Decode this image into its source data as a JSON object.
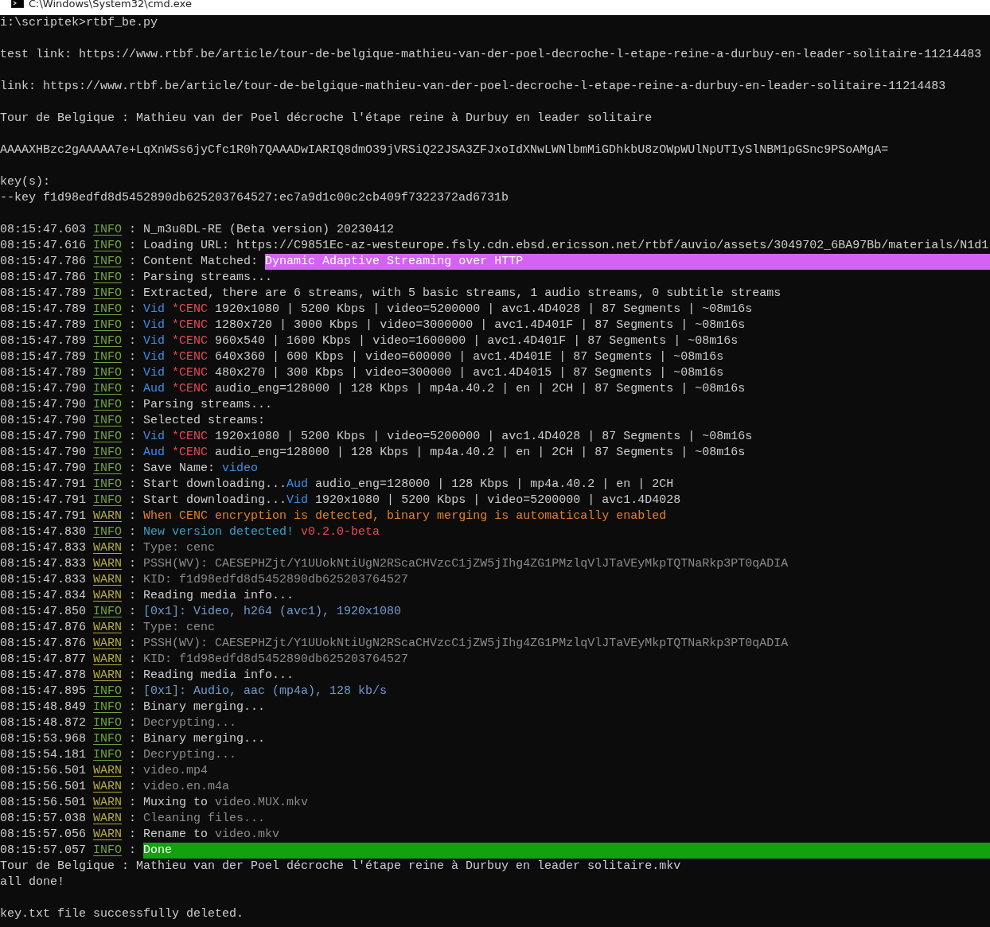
{
  "window": {
    "title": "C:\\Windows\\System32\\cmd.exe"
  },
  "lines": [
    {
      "kind": "plain",
      "text": "i:\\scriptek>rtbf_be.py"
    },
    {
      "kind": "blank"
    },
    {
      "kind": "plain",
      "text": "test link: https://www.rtbf.be/article/tour-de-belgique-mathieu-van-der-poel-decroche-l-etape-reine-a-durbuy-en-leader-solitaire-11214483"
    },
    {
      "kind": "blank"
    },
    {
      "kind": "plain",
      "text": "link: https://www.rtbf.be/article/tour-de-belgique-mathieu-van-der-poel-decroche-l-etape-reine-a-durbuy-en-leader-solitaire-11214483"
    },
    {
      "kind": "blank"
    },
    {
      "kind": "plain",
      "text": "Tour de Belgique : Mathieu van der Poel décroche l'étape reine à Durbuy en leader solitaire"
    },
    {
      "kind": "blank"
    },
    {
      "kind": "plain",
      "text": "AAAAXHBzc2gAAAAA7e+LqXnWSs6jyCfc1R0h7QAAADwIARIQ8dmO39jVRSiQ22JSA3ZFJxoIdXNwLWNlbmMiGDhkbU8zOWpWUlNpUTIySlNBM1pGSnc9PSoAMgA="
    },
    {
      "kind": "blank"
    },
    {
      "kind": "plain",
      "text": "key(s):"
    },
    {
      "kind": "plain",
      "text": "--key f1d98edfd8d5452890db625203764527:ec7a9d1c00c2cb409f7322372ad6731b"
    },
    {
      "kind": "blank"
    },
    {
      "kind": "log",
      "time": "08:15:47.603",
      "level": "INFO",
      "sep": ":",
      "parts": [
        {
          "text": "N_m3u8DL-RE (Beta version) 20230412",
          "kind": "normal"
        }
      ]
    },
    {
      "kind": "log",
      "time": "08:15:47.616",
      "level": "INFO",
      "sep": ":",
      "parts": [
        {
          "text": "Loading URL: https://C9851Ec-az-westeurope.fsly.cdn.ebsd.ericsson.net/rtbf/auvio/assets/3049702_6BA97Bb/materials/N1d1",
          "kind": "normal"
        }
      ]
    },
    {
      "kind": "log",
      "time": "08:15:47.786",
      "level": "INFO",
      "sep": ":",
      "parts": [
        {
          "text": "Content Matched:",
          "kind": "normal"
        },
        {
          "text": "Dynamic Adaptive Streaming over HTTP",
          "kind": "magenta-bar"
        }
      ]
    },
    {
      "kind": "log",
      "time": "08:15:47.786",
      "level": "INFO",
      "sep": ":",
      "parts": [
        {
          "text": "Parsing streams...",
          "kind": "normal"
        }
      ]
    },
    {
      "kind": "log",
      "time": "08:15:47.789",
      "level": "INFO",
      "sep": ":",
      "parts": [
        {
          "text": "Extracted, there are 6 streams, with 5 basic streams, 1 audio streams, 0 subtitle streams",
          "kind": "normal"
        }
      ]
    },
    {
      "kind": "log",
      "time": "08:15:47.789",
      "level": "INFO",
      "sep": ":",
      "parts": [
        {
          "text": "Vid",
          "kind": "blue"
        },
        {
          "text": "*CENC",
          "kind": "red"
        },
        {
          "text": "1920x1080 | 5200 Kbps | video=5200000 | avc1.4D4028 | 87 Segments | ~08m16s",
          "kind": "normal"
        }
      ]
    },
    {
      "kind": "log",
      "time": "08:15:47.789",
      "level": "INFO",
      "sep": ":",
      "parts": [
        {
          "text": "Vid",
          "kind": "blue"
        },
        {
          "text": "*CENC",
          "kind": "red"
        },
        {
          "text": "1280x720 | 3000 Kbps | video=3000000 | avc1.4D401F | 87 Segments | ~08m16s",
          "kind": "normal"
        }
      ]
    },
    {
      "kind": "log",
      "time": "08:15:47.789",
      "level": "INFO",
      "sep": ":",
      "parts": [
        {
          "text": "Vid",
          "kind": "blue"
        },
        {
          "text": "*CENC",
          "kind": "red"
        },
        {
          "text": "960x540 | 1600 Kbps | video=1600000 | avc1.4D401F | 87 Segments | ~08m16s",
          "kind": "normal"
        }
      ]
    },
    {
      "kind": "log",
      "time": "08:15:47.789",
      "level": "INFO",
      "sep": ":",
      "parts": [
        {
          "text": "Vid",
          "kind": "blue"
        },
        {
          "text": "*CENC",
          "kind": "red"
        },
        {
          "text": "640x360 | 600 Kbps | video=600000 | avc1.4D401E | 87 Segments | ~08m16s",
          "kind": "normal"
        }
      ]
    },
    {
      "kind": "log",
      "time": "08:15:47.789",
      "level": "INFO",
      "sep": ":",
      "parts": [
        {
          "text": "Vid",
          "kind": "blue"
        },
        {
          "text": "*CENC",
          "kind": "red"
        },
        {
          "text": "480x270 | 300 Kbps | video=300000 | avc1.4D4015 | 87 Segments | ~08m16s",
          "kind": "normal"
        }
      ]
    },
    {
      "kind": "log",
      "time": "08:15:47.790",
      "level": "INFO",
      "sep": ":",
      "parts": [
        {
          "text": "Aud",
          "kind": "blue"
        },
        {
          "text": "*CENC",
          "kind": "red"
        },
        {
          "text": "audio_eng=128000 | 128 Kbps | mp4a.40.2 | en | 2CH | 87 Segments | ~08m16s",
          "kind": "normal"
        }
      ]
    },
    {
      "kind": "log",
      "time": "08:15:47.790",
      "level": "INFO",
      "sep": ":",
      "parts": [
        {
          "text": "Parsing streams...",
          "kind": "normal"
        }
      ]
    },
    {
      "kind": "log",
      "time": "08:15:47.790",
      "level": "INFO",
      "sep": ":",
      "parts": [
        {
          "text": "Selected streams:",
          "kind": "normal"
        }
      ]
    },
    {
      "kind": "log",
      "time": "08:15:47.790",
      "level": "INFO",
      "sep": ":",
      "parts": [
        {
          "text": "Vid",
          "kind": "blue"
        },
        {
          "text": "*CENC",
          "kind": "red"
        },
        {
          "text": "1920x1080 | 5200 Kbps | video=5200000 | avc1.4D4028 | 87 Segments | ~08m16s",
          "kind": "normal"
        }
      ]
    },
    {
      "kind": "log",
      "time": "08:15:47.790",
      "level": "INFO",
      "sep": ":",
      "parts": [
        {
          "text": "Aud",
          "kind": "blue"
        },
        {
          "text": "*CENC",
          "kind": "red"
        },
        {
          "text": "audio_eng=128000 | 128 Kbps | mp4a.40.2 | en | 2CH | 87 Segments | ~08m16s",
          "kind": "normal"
        }
      ]
    },
    {
      "kind": "log",
      "time": "08:15:47.790",
      "level": "INFO",
      "sep": ":",
      "parts": [
        {
          "text": "Save Name:",
          "kind": "normal"
        },
        {
          "text": "video",
          "kind": "blue"
        }
      ]
    },
    {
      "kind": "log",
      "time": "08:15:47.791",
      "level": "INFO",
      "sep": ":",
      "parts": [
        {
          "text": "Start downloading...",
          "kind": "normal",
          "joined": true
        },
        {
          "text": "Aud",
          "kind": "blue"
        },
        {
          "text": "audio_eng=128000 | 128 Kbps | mp4a.40.2 | en | 2CH",
          "kind": "normal"
        }
      ]
    },
    {
      "kind": "log",
      "time": "08:15:47.791",
      "level": "INFO",
      "sep": ":",
      "parts": [
        {
          "text": "Start downloading...",
          "kind": "normal",
          "joined": true
        },
        {
          "text": "Vid",
          "kind": "blue"
        },
        {
          "text": "1920x1080 | 5200 Kbps | video=5200000 | avc1.4D4028",
          "kind": "normal"
        }
      ]
    },
    {
      "kind": "log",
      "time": "08:15:47.791",
      "level": "WARN",
      "sep": ":",
      "parts": [
        {
          "text": "When CENC encryption is detected, binary merging is automatically enabled",
          "kind": "orange"
        }
      ]
    },
    {
      "kind": "log",
      "time": "08:15:47.830",
      "level": "INFO",
      "sep": ":",
      "parts": [
        {
          "text": "New version detected!",
          "kind": "cyan"
        },
        {
          "text": "v0.2.0-beta",
          "kind": "red"
        }
      ]
    },
    {
      "kind": "log",
      "time": "08:15:47.833",
      "level": "WARN",
      "sep": ":",
      "parts": [
        {
          "text": "Type: cenc",
          "kind": "dim"
        }
      ]
    },
    {
      "kind": "log",
      "time": "08:15:47.833",
      "level": "WARN",
      "sep": ":",
      "parts": [
        {
          "text": "PSSH(WV): CAESEPHZjt/Y1UUokNtiUgN2RScaCHVzcC1jZW5jIhg4ZG1PMzlqVlJTaVEyMkpTQTNaRkp3PT0qADIA",
          "kind": "dim"
        }
      ]
    },
    {
      "kind": "log",
      "time": "08:15:47.833",
      "level": "WARN",
      "sep": ":",
      "parts": [
        {
          "text": "KID: f1d98edfd8d5452890db625203764527",
          "kind": "dim"
        }
      ]
    },
    {
      "kind": "log",
      "time": "08:15:47.834",
      "level": "WARN",
      "sep": ":",
      "parts": [
        {
          "text": "Reading media info...",
          "kind": "normal"
        }
      ]
    },
    {
      "kind": "log",
      "time": "08:15:47.850",
      "level": "INFO",
      "sep": ":",
      "parts": [
        {
          "text": "[0x1]: Video, h264 (avc1), 1920x1080",
          "kind": "steel"
        }
      ]
    },
    {
      "kind": "log",
      "time": "08:15:47.876",
      "level": "WARN",
      "sep": ":",
      "parts": [
        {
          "text": "Type: cenc",
          "kind": "dim"
        }
      ]
    },
    {
      "kind": "log",
      "time": "08:15:47.876",
      "level": "WARN",
      "sep": ":",
      "parts": [
        {
          "text": "PSSH(WV): CAESEPHZjt/Y1UUokNtiUgN2RScaCHVzcC1jZW5jIhg4ZG1PMzlqVlJTaVEyMkpTQTNaRkp3PT0qADIA",
          "kind": "dim"
        }
      ]
    },
    {
      "kind": "log",
      "time": "08:15:47.877",
      "level": "WARN",
      "sep": ":",
      "parts": [
        {
          "text": "KID: f1d98edfd8d5452890db625203764527",
          "kind": "dim"
        }
      ]
    },
    {
      "kind": "log",
      "time": "08:15:47.878",
      "level": "WARN",
      "sep": ":",
      "parts": [
        {
          "text": "Reading media info...",
          "kind": "normal"
        }
      ]
    },
    {
      "kind": "log",
      "time": "08:15:47.895",
      "level": "INFO",
      "sep": ":",
      "parts": [
        {
          "text": "[0x1]: Audio, aac (mp4a), 128 kb/s",
          "kind": "steel"
        }
      ]
    },
    {
      "kind": "log",
      "time": "08:15:48.849",
      "level": "INFO",
      "sep": ":",
      "parts": [
        {
          "text": "Binary merging...",
          "kind": "normal"
        }
      ]
    },
    {
      "kind": "log",
      "time": "08:15:48.872",
      "level": "INFO",
      "sep": ":",
      "parts": [
        {
          "text": "Decrypting...",
          "kind": "dim"
        }
      ]
    },
    {
      "kind": "log",
      "time": "08:15:53.968",
      "level": "INFO",
      "sep": ":",
      "parts": [
        {
          "text": "Binary merging...",
          "kind": "normal"
        }
      ]
    },
    {
      "kind": "log",
      "time": "08:15:54.181",
      "level": "INFO",
      "sep": ":",
      "parts": [
        {
          "text": "Decrypting...",
          "kind": "dim"
        }
      ]
    },
    {
      "kind": "log",
      "time": "08:15:56.501",
      "level": "WARN",
      "sep": ":",
      "parts": [
        {
          "text": "video.mp4",
          "kind": "dim"
        }
      ]
    },
    {
      "kind": "log",
      "time": "08:15:56.501",
      "level": "WARN",
      "sep": ":",
      "parts": [
        {
          "text": "video.en.m4a",
          "kind": "dim"
        }
      ]
    },
    {
      "kind": "log",
      "time": "08:15:56.501",
      "level": "WARN",
      "sep": ":",
      "parts": [
        {
          "text": "Muxing to",
          "kind": "normal"
        },
        {
          "text": "video.MUX.mkv",
          "kind": "dim"
        }
      ]
    },
    {
      "kind": "log",
      "time": "08:15:57.038",
      "level": "WARN",
      "sep": ":",
      "parts": [
        {
          "text": "Cleaning files...",
          "kind": "dim"
        }
      ]
    },
    {
      "kind": "log",
      "time": "08:15:57.056",
      "level": "WARN",
      "sep": ":",
      "parts": [
        {
          "text": "Rename to",
          "kind": "normal"
        },
        {
          "text": "video.mkv",
          "kind": "dim"
        }
      ]
    },
    {
      "kind": "log",
      "time": "08:15:57.057",
      "level": "INFO",
      "sep": ":",
      "parts": [
        {
          "text": "Done",
          "kind": "green-bar"
        }
      ]
    },
    {
      "kind": "plain",
      "text": "Tour de Belgique : Mathieu van der Poel décroche l'étape reine à Durbuy en leader solitaire.mkv"
    },
    {
      "kind": "plain",
      "text": "all done!"
    },
    {
      "kind": "blank"
    },
    {
      "kind": "plain",
      "text": "key.txt file successfully deleted."
    }
  ]
}
